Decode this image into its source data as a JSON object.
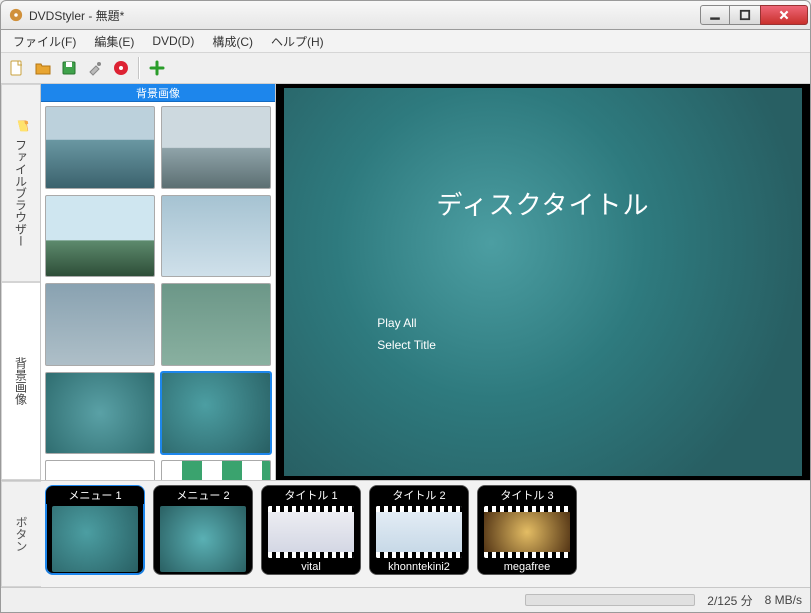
{
  "window": {
    "title": "DVDStyler - 無題*"
  },
  "menubar": [
    {
      "label": "ファイル(F)"
    },
    {
      "label": "編集(E)"
    },
    {
      "label": "DVD(D)"
    },
    {
      "label": "構成(C)"
    },
    {
      "label": "ヘルプ(H)"
    }
  ],
  "side_tabs": {
    "file_browser": "ファイルブラウザー",
    "backgrounds": "背景画像",
    "buttons": "ボタン"
  },
  "browser": {
    "header": "背景画像",
    "selected_index": 7
  },
  "dvd_menu": {
    "title": "ディスクタイトル",
    "items": [
      "Play All",
      "Select Title"
    ]
  },
  "timeline": [
    {
      "kind": "menu",
      "top": "メニュー 1",
      "bottom": "",
      "selected": true
    },
    {
      "kind": "menu",
      "top": "メニュー 2",
      "bottom": "",
      "selected": false
    },
    {
      "kind": "video",
      "top": "タイトル 1",
      "bottom": "vital",
      "selected": false
    },
    {
      "kind": "video",
      "top": "タイトル 2",
      "bottom": "khonntekini2",
      "selected": false
    },
    {
      "kind": "video",
      "top": "タイトル 3",
      "bottom": "megafree",
      "selected": false
    }
  ],
  "status": {
    "duration": "2/125 分",
    "bitrate": "8 MB/s"
  }
}
